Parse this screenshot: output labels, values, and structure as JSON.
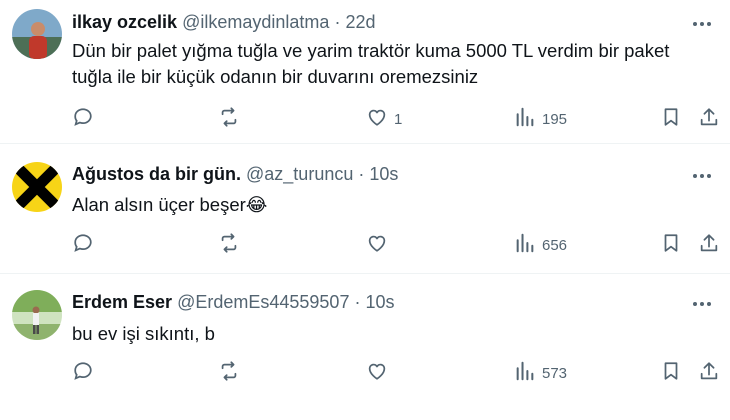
{
  "tweets": [
    {
      "name": "ilkay ozcelik",
      "handle": "@ilkemaydinlatma",
      "separator": "·",
      "time": "22d",
      "text": "Dün bir palet yığma tuğla ve yarim traktör kuma 5000 TL verdim bir paket tuğla ile bir küçük odanın bir duvarını oremezsiniz",
      "likes": "1",
      "views": "195"
    },
    {
      "name": "Ağustos da bir gün.",
      "handle": "@az_turuncu",
      "separator": "·",
      "time": "10s",
      "text": "Alan alsın üçer beşer😂",
      "views": "656"
    },
    {
      "name": "Erdem Eser",
      "handle": "@ErdemEs44559507",
      "separator": "·",
      "time": "10s",
      "text": "bu ev işi sıkıntı,  b",
      "views": "573"
    }
  ],
  "icons": {
    "reply": "reply-icon",
    "retweet": "retweet-icon",
    "like": "heart-icon",
    "views": "views-icon",
    "bookmark": "bookmark-icon",
    "share": "share-icon",
    "more": "more-icon"
  },
  "colors": {
    "text": "#0f1419",
    "secondary": "#536471",
    "divider": "#eff3f4",
    "avatar2_yellow": "#f7d417"
  }
}
